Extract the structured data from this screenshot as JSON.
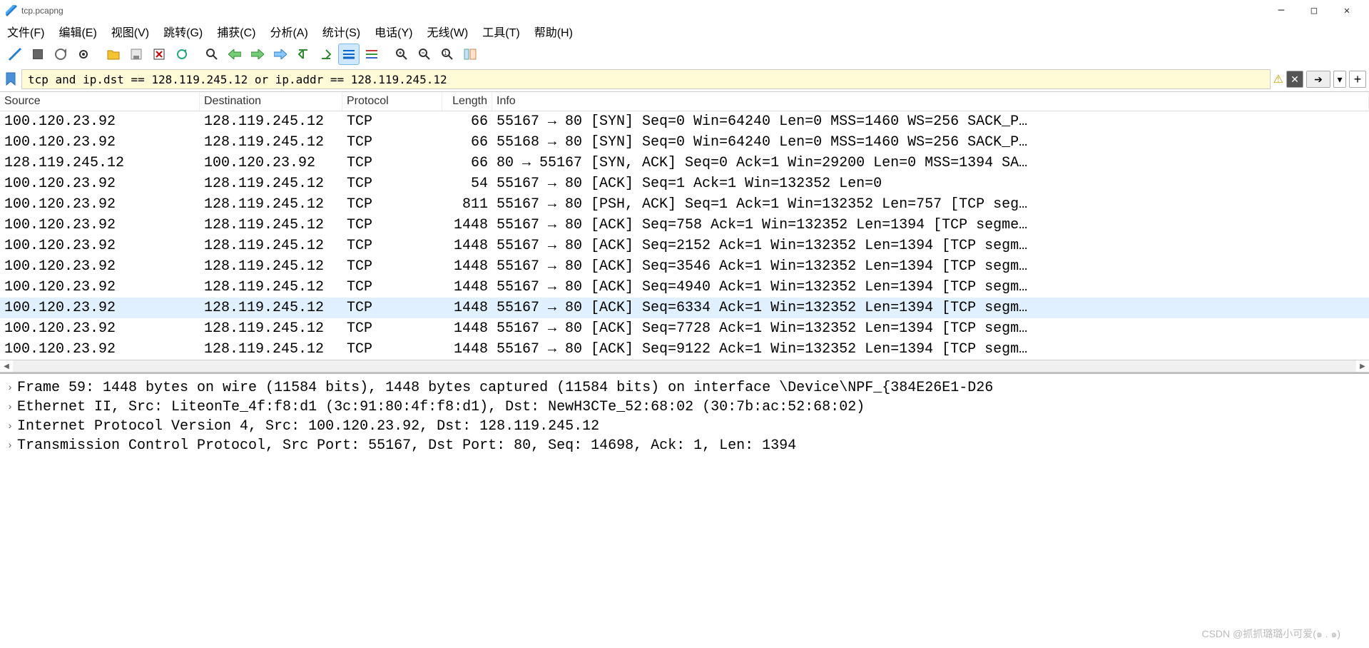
{
  "window": {
    "title": "tcp.pcapng"
  },
  "menu": {
    "file": "文件(F)",
    "edit": "编辑(E)",
    "view": "视图(V)",
    "goto": "跳转(G)",
    "capture": "捕获(C)",
    "analyze": "分析(A)",
    "stats": "统计(S)",
    "telephony": "电话(Y)",
    "wireless": "无线(W)",
    "tools": "工具(T)",
    "help": "帮助(H)"
  },
  "filter": {
    "value": "tcp and ip.dst == 128.119.245.12 or ip.addr == 128.119.245.12"
  },
  "columns": {
    "source": "Source",
    "destination": "Destination",
    "protocol": "Protocol",
    "length": "Length",
    "info": "Info"
  },
  "packets": [
    {
      "src": "100.120.23.92",
      "dst": "128.119.245.12",
      "proto": "TCP",
      "len": "66",
      "info": "55167 → 80 [SYN] Seq=0 Win=64240 Len=0 MSS=1460 WS=256 SACK_P…"
    },
    {
      "src": "100.120.23.92",
      "dst": "128.119.245.12",
      "proto": "TCP",
      "len": "66",
      "info": "55168 → 80 [SYN] Seq=0 Win=64240 Len=0 MSS=1460 WS=256 SACK_P…"
    },
    {
      "src": "128.119.245.12",
      "dst": "100.120.23.92",
      "proto": "TCP",
      "len": "66",
      "info": "80 → 55167 [SYN, ACK] Seq=0 Ack=1 Win=29200 Len=0 MSS=1394 SA…"
    },
    {
      "src": "100.120.23.92",
      "dst": "128.119.245.12",
      "proto": "TCP",
      "len": "54",
      "info": "55167 → 80 [ACK] Seq=1 Ack=1 Win=132352 Len=0"
    },
    {
      "src": "100.120.23.92",
      "dst": "128.119.245.12",
      "proto": "TCP",
      "len": "811",
      "info": "55167 → 80 [PSH, ACK] Seq=1 Ack=1 Win=132352 Len=757 [TCP seg…"
    },
    {
      "src": "100.120.23.92",
      "dst": "128.119.245.12",
      "proto": "TCP",
      "len": "1448",
      "info": "55167 → 80 [ACK] Seq=758 Ack=1 Win=132352 Len=1394 [TCP segme…"
    },
    {
      "src": "100.120.23.92",
      "dst": "128.119.245.12",
      "proto": "TCP",
      "len": "1448",
      "info": "55167 → 80 [ACK] Seq=2152 Ack=1 Win=132352 Len=1394 [TCP segm…"
    },
    {
      "src": "100.120.23.92",
      "dst": "128.119.245.12",
      "proto": "TCP",
      "len": "1448",
      "info": "55167 → 80 [ACK] Seq=3546 Ack=1 Win=132352 Len=1394 [TCP segm…"
    },
    {
      "src": "100.120.23.92",
      "dst": "128.119.245.12",
      "proto": "TCP",
      "len": "1448",
      "info": "55167 → 80 [ACK] Seq=4940 Ack=1 Win=132352 Len=1394 [TCP segm…"
    },
    {
      "src": "100.120.23.92",
      "dst": "128.119.245.12",
      "proto": "TCP",
      "len": "1448",
      "info": "55167 → 80 [ACK] Seq=6334 Ack=1 Win=132352 Len=1394 [TCP segm…",
      "selected": true
    },
    {
      "src": "100.120.23.92",
      "dst": "128.119.245.12",
      "proto": "TCP",
      "len": "1448",
      "info": "55167 → 80 [ACK] Seq=7728 Ack=1 Win=132352 Len=1394 [TCP segm…"
    },
    {
      "src": "100.120.23.92",
      "dst": "128.119.245.12",
      "proto": "TCP",
      "len": "1448",
      "info": "55167 → 80 [ACK] Seq=9122 Ack=1 Win=132352 Len=1394 [TCP segm…"
    }
  ],
  "details": [
    "Frame 59: 1448 bytes on wire (11584 bits), 1448 bytes captured (11584 bits) on interface \\Device\\NPF_{384E26E1-D26",
    "Ethernet II, Src: LiteonTe_4f:f8:d1 (3c:91:80:4f:f8:d1), Dst: NewH3CTe_52:68:02 (30:7b:ac:52:68:02)",
    "Internet Protocol Version 4, Src: 100.120.23.92, Dst: 128.119.245.12",
    "Transmission Control Protocol, Src Port: 55167, Dst Port: 80, Seq: 14698, Ack: 1, Len: 1394"
  ],
  "watermark": "CSDN @抓抓璐璐小可爱(๑ . ๑)"
}
